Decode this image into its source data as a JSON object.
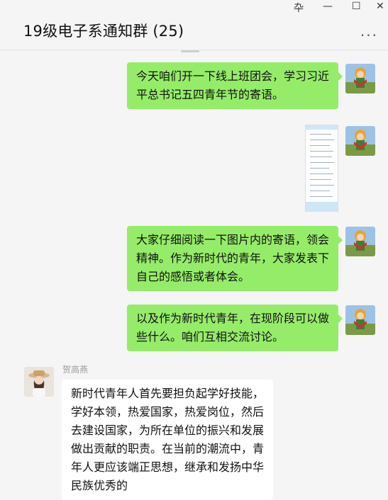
{
  "window": {
    "title": "19级电子系通知群 (25)",
    "controls": {
      "pin": "卆",
      "minimize": "—",
      "maximize": "☐",
      "close": "✕"
    },
    "more": "···"
  },
  "messages": [
    {
      "from": "me",
      "text": "今天咱们开一下线上班团会，学习习近平总书记五四青年节的寄语。"
    },
    {
      "from": "me",
      "type": "image"
    },
    {
      "from": "me",
      "text": "大家仔细阅读一下图片内的寄语，领会精神。作为新时代的青年，大家发表下自己的感悟或者体会。"
    },
    {
      "from": "me",
      "text": "以及作为新时代青年，在现阶段可以做些什么。咱们互相交流讨论。"
    },
    {
      "from": "other",
      "sender": "贺高燕",
      "text": "新时代青年人首先要担负起学好技能，学好本领，热爱国家，热爱岗位，然后去建设国家，为所在单位的振兴和发展做出贡献的职责。在当前的潮流中，青年人更应该端正思想，继承和发扬中华民族优秀的"
    }
  ],
  "colors": {
    "my_bubble": "#95ec69",
    "other_bubble": "#ffffff",
    "background": "#f5f5f5"
  }
}
